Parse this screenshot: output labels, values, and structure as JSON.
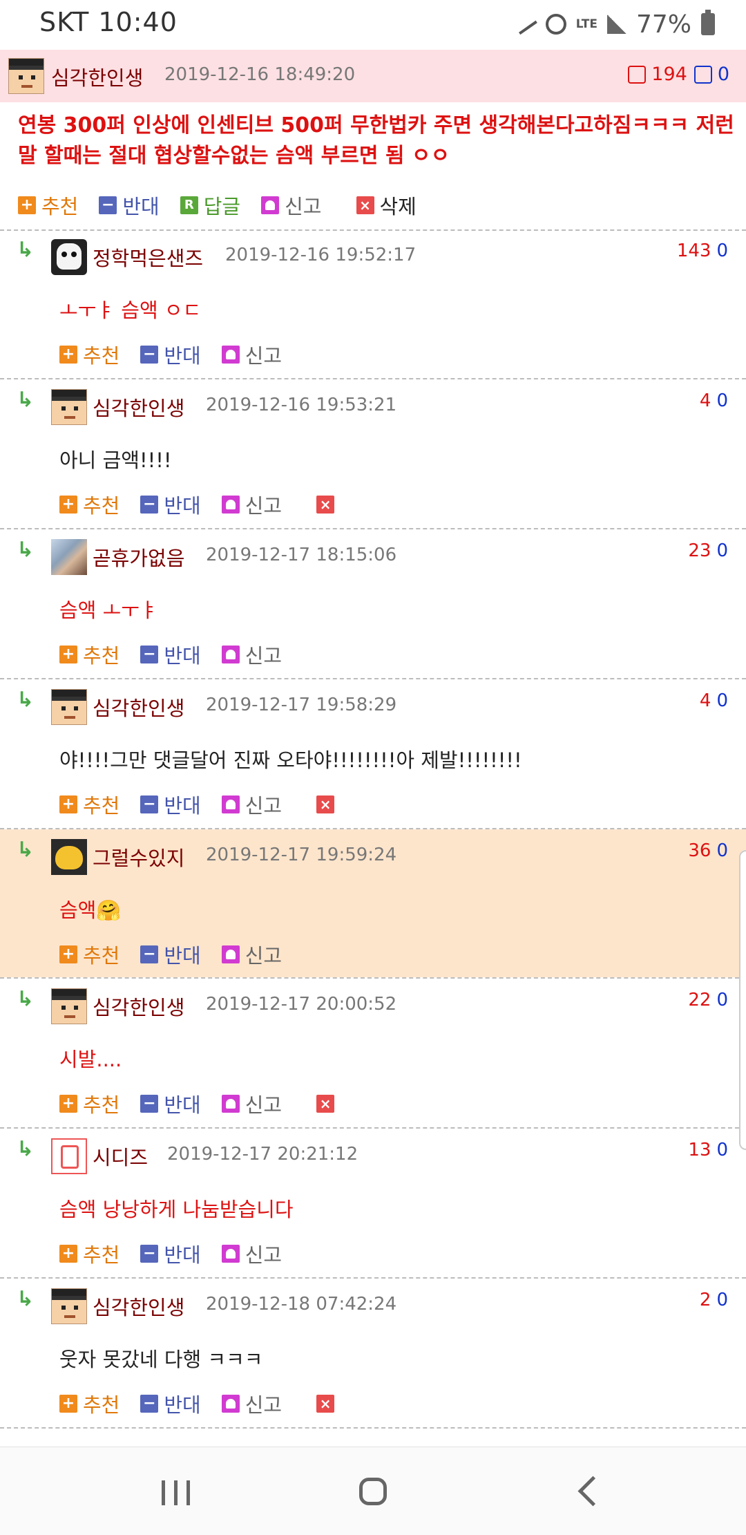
{
  "status_bar": {
    "carrier_time": "SKT 10:40",
    "network": "LTE",
    "battery": "77%"
  },
  "main_comment": {
    "nick": "심각한인생",
    "date": "2019-12-16 18:49:20",
    "up": "194",
    "down": "0",
    "text": "연봉 300퍼 인상에 인센티브 500퍼 무한법카 주면 생각해본다고하짐ㅋㅋㅋ 저런말 할때는 절대 협상할수없는 슴액 부르면 됨 ㅇㅇ",
    "actions": {
      "recommend": "추천",
      "oppose": "반대",
      "reply": "답글",
      "report": "신고",
      "delete": "삭제"
    }
  },
  "labels": {
    "recommend": "추천",
    "oppose": "반대",
    "report": "신고",
    "reply_arrow": "↳"
  },
  "replies": [
    {
      "nick": "정학먹은샌즈",
      "date": "2019-12-16 19:52:17",
      "up": "143",
      "down": "0",
      "text": "ㅗㅜㅑ 슴액 ㅇㄷ",
      "color": "#dd1111"
    },
    {
      "nick": "심각한인생",
      "date": "2019-12-16 19:53:21",
      "up": "4",
      "down": "0",
      "text": "아니 금액!!!!",
      "color": "#222222"
    },
    {
      "nick": "곧휴가없음",
      "date": "2019-12-17 18:15:06",
      "up": "23",
      "down": "0",
      "text": "슴액 ㅗㅜㅑ",
      "color": "#dd1111"
    },
    {
      "nick": "심각한인생",
      "date": "2019-12-17 19:58:29",
      "up": "4",
      "down": "0",
      "text": "야!!!!그만 댓글달어 진짜 오타야!!!!!!!!아 제발!!!!!!!!",
      "color": "#222222"
    },
    {
      "nick": "그럴수있지",
      "date": "2019-12-17 19:59:24",
      "up": "36",
      "down": "0",
      "text": "슴액🤗",
      "color": "#dd1111"
    },
    {
      "nick": "심각한인생",
      "date": "2019-12-17 20:00:52",
      "up": "22",
      "down": "0",
      "text": "시발....",
      "color": "#dd1111"
    },
    {
      "nick": "시디즈",
      "date": "2019-12-17 20:21:12",
      "up": "13",
      "down": "0",
      "text": "슴액 낭낭하게 나눔받습니다",
      "color": "#dd1111"
    },
    {
      "nick": "심각한인생",
      "date": "2019-12-18 07:42:24",
      "up": "2",
      "down": "0",
      "text": "웃자 못갔네 다행 ㅋㅋㅋ",
      "color": "#222222"
    }
  ]
}
